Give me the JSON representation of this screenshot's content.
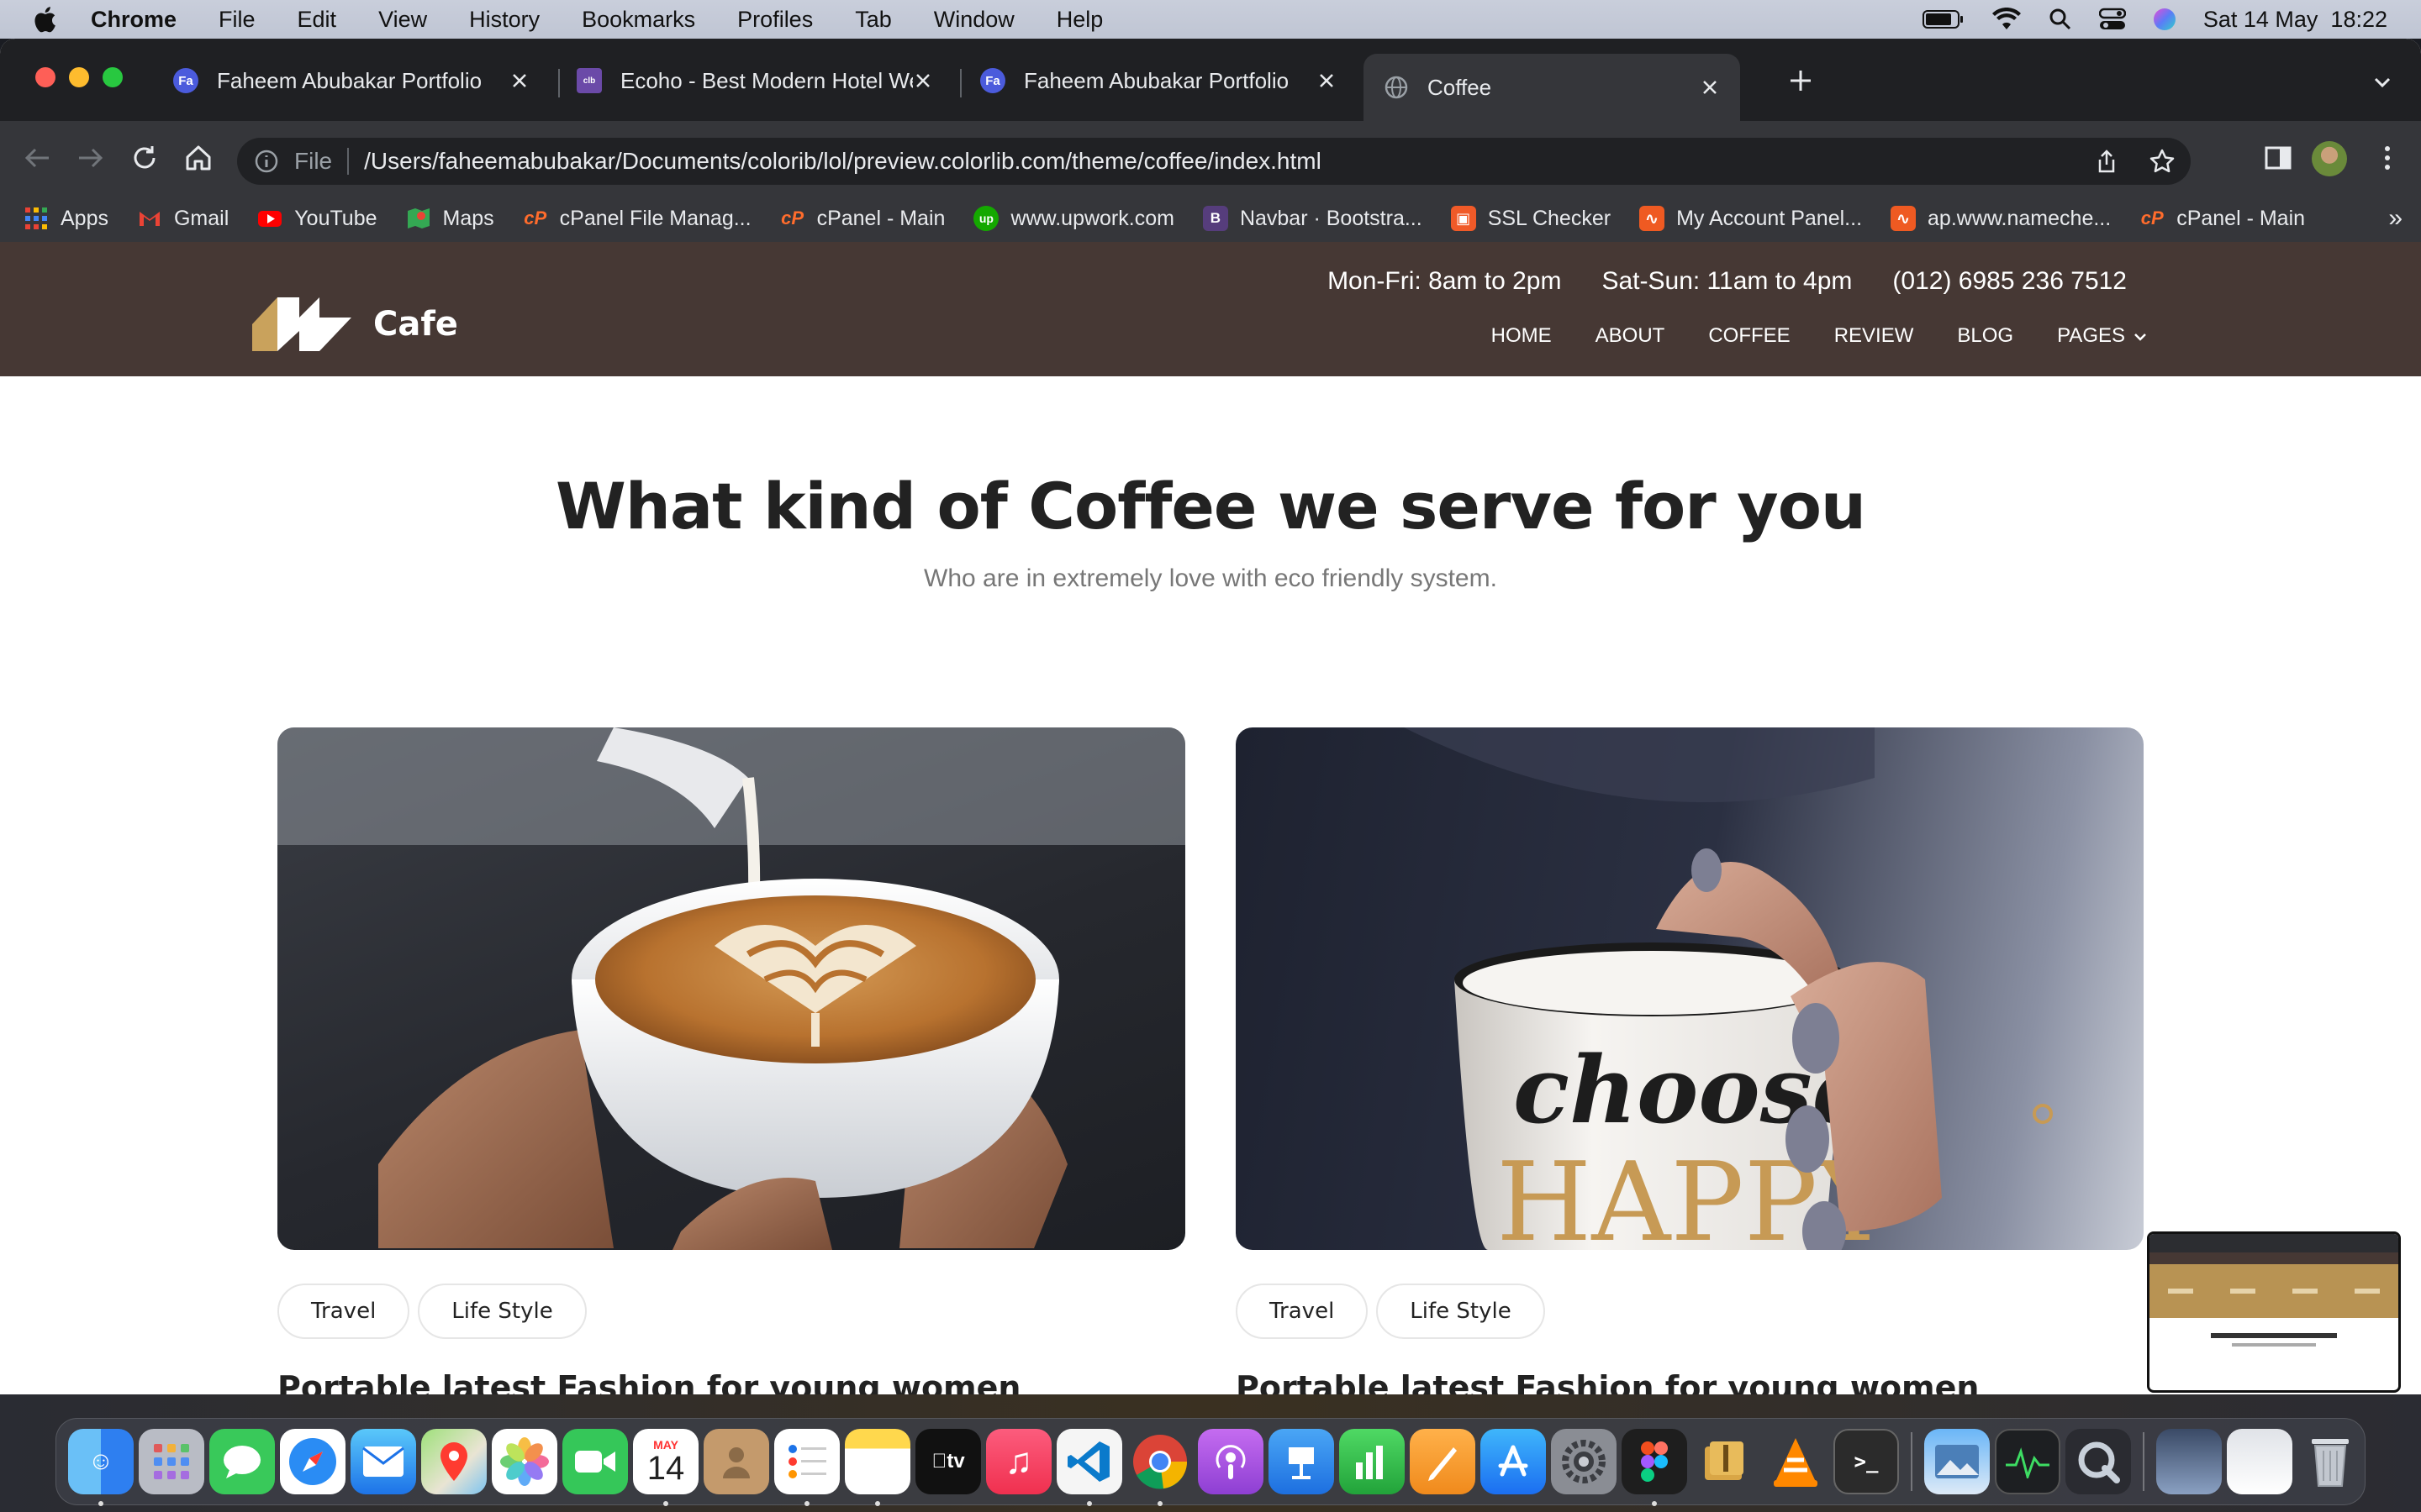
{
  "menubar": {
    "app_name": "Chrome",
    "items": [
      "File",
      "Edit",
      "View",
      "History",
      "Bookmarks",
      "Profiles",
      "Tab",
      "Window",
      "Help"
    ],
    "datetime": "Sat 14 May  18:22"
  },
  "tabs": [
    {
      "title": "Faheem Abubakar Portfolio",
      "favicon": "fa-icon",
      "active": false
    },
    {
      "title": "Ecoho - Best Modern Hotel We",
      "favicon": "colorlib-icon",
      "active": false
    },
    {
      "title": "Faheem Abubakar Portfolio",
      "favicon": "fa-icon",
      "active": false
    },
    {
      "title": "Coffee",
      "favicon": "globe-icon",
      "active": true
    }
  ],
  "omnibox": {
    "scheme_label": "File",
    "url": "/Users/faheemabubakar/Documents/colorib/lol/preview.colorlib.com/theme/coffee/index.html"
  },
  "bookmarks": [
    {
      "label": "Apps",
      "icon": "apps-grid-icon"
    },
    {
      "label": "Gmail",
      "icon": "gmail-icon"
    },
    {
      "label": "YouTube",
      "icon": "youtube-icon"
    },
    {
      "label": "Maps",
      "icon": "maps-icon"
    },
    {
      "label": "cPanel File Manag...",
      "icon": "cpanel-icon"
    },
    {
      "label": "cPanel - Main",
      "icon": "cpanel-icon"
    },
    {
      "label": "www.upwork.com",
      "icon": "upwork-icon"
    },
    {
      "label": "Navbar · Bootstra...",
      "icon": "bootstrap-icon"
    },
    {
      "label": "SSL Checker",
      "icon": "lock-icon"
    },
    {
      "label": "My Account Panel...",
      "icon": "namecheap-icon"
    },
    {
      "label": "ap.www.nameche...",
      "icon": "namecheap-icon"
    },
    {
      "label": "cPanel - Main",
      "icon": "cpanel-icon"
    }
  ],
  "site": {
    "logo_text": "Cafe",
    "hours_weekday": "Mon-Fri: 8am to 2pm",
    "hours_weekend": "Sat-Sun: 11am to 4pm",
    "phone": "(012) 6985 236 7512",
    "nav": [
      "HOME",
      "ABOUT",
      "COFFEE",
      "REVIEW",
      "BLOG",
      "PAGES"
    ],
    "section_title": "What kind of Coffee we serve for you",
    "section_subtitle": "Who are in extremely love with eco friendly system.",
    "cards": [
      {
        "tags": [
          "Travel",
          "Life Style"
        ],
        "title": "Portable latest Fashion for young women",
        "image": "latte-art-photo"
      },
      {
        "tags": [
          "Travel",
          "Life Style"
        ],
        "title": "Portable latest Fashion for young women",
        "image": "choose-happy-mug-photo",
        "mug_text_top": "choose",
        "mug_text_bottom": "HAPPY"
      }
    ]
  },
  "colors": {
    "header_bg": "#463834",
    "accent_gold": "#c9a25c",
    "chrome_dark": "#35363a"
  }
}
